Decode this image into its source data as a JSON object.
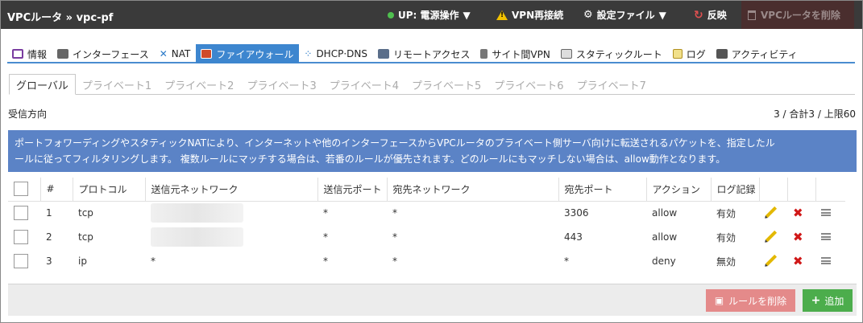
{
  "topbar": {
    "breadcrumb": "VPCルータ » vpc-pf",
    "status": "UP: 電源操作",
    "vpn_reconnect": "VPN再接続",
    "settings_file": "設定ファイル",
    "apply": "反映",
    "delete_router": "VPCルータを削除"
  },
  "main_tabs": [
    "情報",
    "インターフェース",
    "NAT",
    "ファイアウォール",
    "DHCP·DNS",
    "リモートアクセス",
    "サイト間VPN",
    "スタティックルート",
    "ログ",
    "アクティビティ"
  ],
  "sub_tabs": [
    "グローバル",
    "プライベート1",
    "プライベート2",
    "プライベート3",
    "プライベート4",
    "プライベート5",
    "プライベート6",
    "プライベート7"
  ],
  "direction": "受信方向",
  "counter": "3 / 合計3 / 上限60",
  "notice_line1": "ポートフォワーディングやスタティックNATにより、インターネットや他のインターフェースからVPCルータのプライベート側サーバ向けに転送されるパケットを、指定したル",
  "notice_line2": "ールに従ってフィルタリングします。 複数ルールにマッチする場合は、若番のルールが優先されます。どのルールにもマッチしない場合は、allow動作となります。",
  "columns": {
    "no": "#",
    "protocol": "プロトコル",
    "src_net": "送信元ネットワーク",
    "src_port": "送信元ポート",
    "dst_net": "宛先ネットワーク",
    "dst_port": "宛先ポート",
    "action": "アクション",
    "log": "ログ記録"
  },
  "rows": [
    {
      "no": "1",
      "protocol": "tcp",
      "src_net": "",
      "src_port": "*",
      "dst_net": "*",
      "dst_port": "3306",
      "action": "allow",
      "log": "有効"
    },
    {
      "no": "2",
      "protocol": "tcp",
      "src_net": "",
      "src_port": "*",
      "dst_net": "*",
      "dst_port": "443",
      "action": "allow",
      "log": "有効"
    },
    {
      "no": "3",
      "protocol": "ip",
      "src_net": "*",
      "src_port": "*",
      "dst_net": "*",
      "dst_port": "*",
      "action": "deny",
      "log": "無効"
    }
  ],
  "footer": {
    "delete_rule": "ルールを削除",
    "add": "追加"
  }
}
